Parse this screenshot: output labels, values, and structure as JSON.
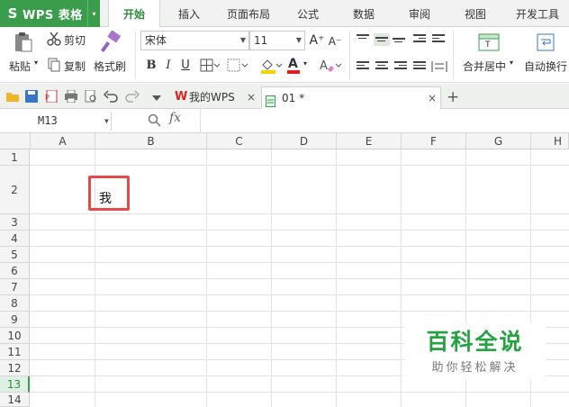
{
  "app": {
    "logo": "S",
    "name": "WPS 表格",
    "dropdown_arrow": "▾"
  },
  "menu_tabs": [
    "开始",
    "插入",
    "页面布局",
    "公式",
    "数据",
    "审阅",
    "视图",
    "开发工具"
  ],
  "ribbon": {
    "cut": "剪切",
    "copy": "复制",
    "paste": "粘贴",
    "format_painter": "格式刷",
    "font_name": "宋体",
    "font_size": "11",
    "bold": "B",
    "italic": "I",
    "underline": "U",
    "font_color_letter": "A",
    "font_grow": "A⁺",
    "font_shrink": "A⁻",
    "merge_center": "合并居中",
    "wrap_text": "自动换行"
  },
  "colors": {
    "brand_green": "#3a9d4b",
    "highlight_yellow": "#f5d200",
    "font_red": "#e02020",
    "annotation_red": "#e34b4b"
  },
  "doc_tabs": [
    {
      "label": "我的WPS"
    },
    {
      "label": "01 *"
    }
  ],
  "doc_tab_close": "×",
  "new_tab": "+",
  "formula_bar": {
    "name_box": "M13",
    "fx": "fx",
    "formula": ""
  },
  "sheet": {
    "columns": [
      "A",
      "B",
      "C",
      "D",
      "E",
      "F",
      "G",
      "H"
    ],
    "rows": [
      "1",
      "2",
      "3",
      "4",
      "5",
      "6",
      "7",
      "8",
      "9",
      "10",
      "11",
      "12",
      "13",
      "14"
    ],
    "selected_row": "13",
    "cells": {
      "B2": "我"
    }
  },
  "watermark": {
    "title": "百科全说",
    "subtitle": "助你轻松解决"
  }
}
